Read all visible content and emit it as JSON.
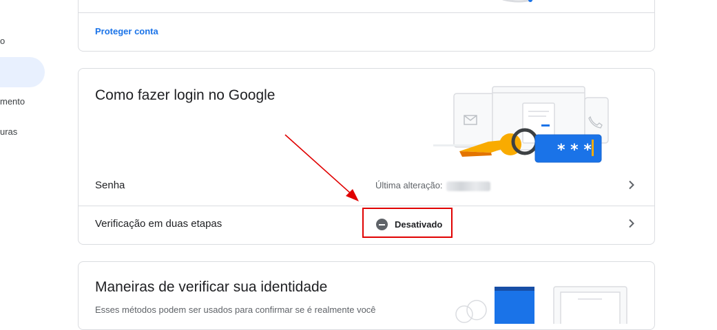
{
  "sidebar": {
    "items": [
      {
        "label": "o"
      },
      {
        "label": ""
      },
      {
        "label": "mento"
      },
      {
        "label": "uras"
      }
    ]
  },
  "protect_card": {
    "link_label": "Proteger conta"
  },
  "login_card": {
    "title": "Como fazer login no Google",
    "rows": [
      {
        "label": "Senha",
        "value": "Última alteração:"
      },
      {
        "label": "Verificação em duas etapas",
        "status": "Desativado"
      }
    ],
    "illustration_text": "* * *"
  },
  "identity_card": {
    "title": "Maneiras de verificar sua identidade",
    "description": "Esses métodos podem ser usados para confirmar se é realmente você"
  },
  "colors": {
    "accent": "#1a73e8",
    "highlight": "#e00000",
    "key_yellow": "#f9ab00"
  },
  "icons": [
    "chevron-right-icon",
    "minus-circle-icon",
    "mail-icon",
    "phone-icon",
    "key-icon",
    "password-card-icon"
  ]
}
